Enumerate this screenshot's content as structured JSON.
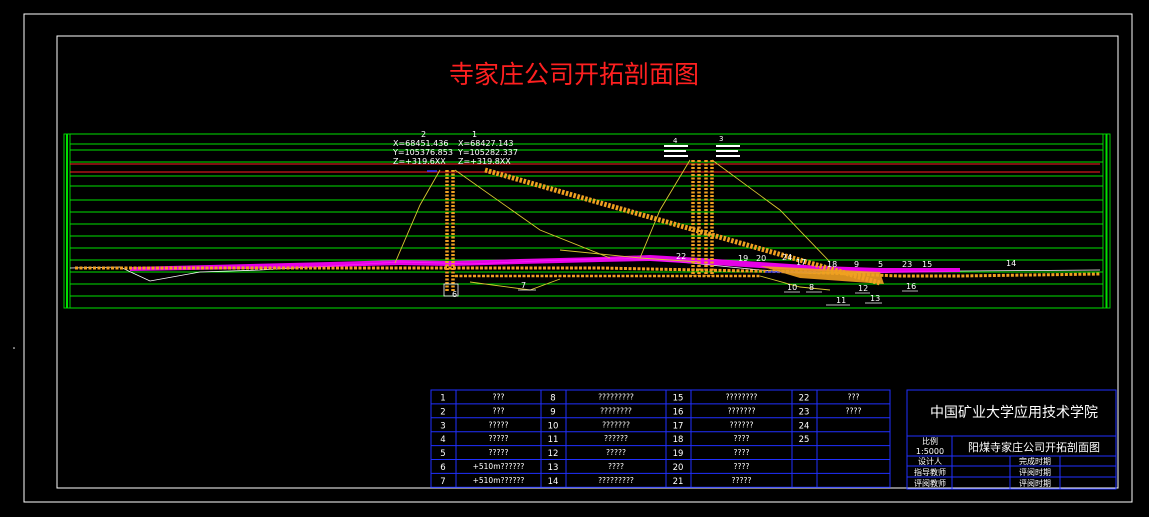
{
  "drawing": {
    "title": "寺家庄公司开拓剖面图",
    "colors": {
      "background": "#000000",
      "frame": "#ffffff",
      "title": "#ff2020",
      "grid": "#00e000",
      "red_line": "#ff2020",
      "roadway": "#f0a020",
      "strata": "#ff00ff",
      "blue": "#2030ff",
      "yellow_line": "#d8c830",
      "table": "#2030ff",
      "text": "#ffffff"
    }
  },
  "shafts": {
    "shaft_2": {
      "number": "2",
      "x": "X=68451.436",
      "y": "Y=105376.853",
      "z": "Z=+319.6XX"
    },
    "shaft_1": {
      "number": "1",
      "x": "X=68427.143",
      "y": "Y=105282.337",
      "z": "Z=+319.8XX"
    },
    "shaft_4": {
      "number": "4"
    },
    "shaft_3": {
      "number": "3"
    }
  },
  "callouts": [
    "22",
    "19",
    "20",
    "24",
    "17",
    "18",
    "9",
    "5",
    "23",
    "15",
    "14",
    "10",
    "8",
    "11",
    "12",
    "13",
    "16",
    "7",
    "6"
  ],
  "legend": {
    "col1": [
      {
        "n": "1",
        "t": "???"
      },
      {
        "n": "2",
        "t": "???"
      },
      {
        "n": "3",
        "t": "?????"
      },
      {
        "n": "4",
        "t": "?????"
      },
      {
        "n": "5",
        "t": "?????"
      },
      {
        "n": "6",
        "t": "+510m??????"
      },
      {
        "n": "7",
        "t": "+510m??????"
      }
    ],
    "col2": [
      {
        "n": "8",
        "t": "?????????"
      },
      {
        "n": "9",
        "t": "????????"
      },
      {
        "n": "10",
        "t": "???????"
      },
      {
        "n": "11",
        "t": "??????"
      },
      {
        "n": "12",
        "t": "?????"
      },
      {
        "n": "13",
        "t": "????"
      },
      {
        "n": "14",
        "t": "?????????"
      }
    ],
    "col3": [
      {
        "n": "15",
        "t": "????????"
      },
      {
        "n": "16",
        "t": "???????"
      },
      {
        "n": "17",
        "t": "??????"
      },
      {
        "n": "18",
        "t": "????"
      },
      {
        "n": "19",
        "t": "????"
      },
      {
        "n": "20",
        "t": "????"
      },
      {
        "n": "21",
        "t": "?????"
      }
    ],
    "col4": [
      {
        "n": "22",
        "t": "???"
      },
      {
        "n": "23",
        "t": "????"
      },
      {
        "n": "24",
        "t": ""
      },
      {
        "n": "25",
        "t": ""
      }
    ]
  },
  "title_block": {
    "institution": "中国矿业大学应用技术学院",
    "drawing_name": "阳煤寺家庄公司开拓剖面图",
    "scale_label": "比例",
    "scale_value": "1:5000",
    "designer": "设计人",
    "advisor": "指导教师",
    "reviewer": "评阅教师",
    "complete_date": "完成时期",
    "review_date_1": "评阅时期",
    "review_date_2": "评阅时期"
  }
}
